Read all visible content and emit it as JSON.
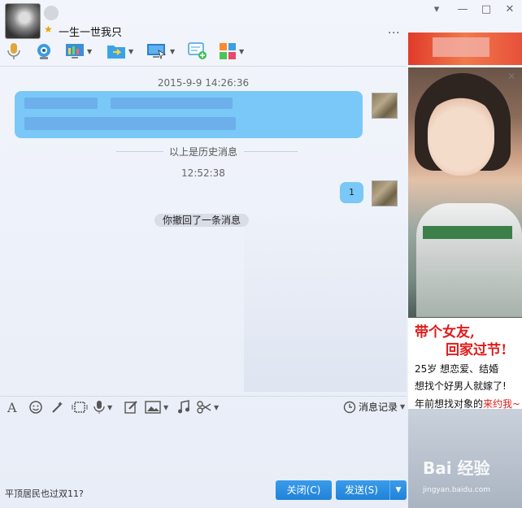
{
  "header": {
    "contact_name": "一生一世我只",
    "more_label": "···",
    "window_controls": [
      "▾",
      "—",
      "□",
      "✕"
    ]
  },
  "toolbar": {
    "icons": [
      "microphone-icon",
      "webcam-icon",
      "screen-share-icon",
      "file-transfer-icon",
      "remote-desktop-icon",
      "add-message-icon",
      "apps-icon"
    ]
  },
  "chat": {
    "timestamp_1": "2015-9-9 14:26:36",
    "history_divider": "以上是历史消息",
    "timestamp_2": "12:52:38",
    "my_message": "1",
    "recall_notice": "你撤回了一条消息"
  },
  "input_toolbar": {
    "history_label": "消息记录"
  },
  "footer": {
    "status_text": "平顶居民也过双11?",
    "close_label": "关闭(C)",
    "send_label": "发送(S)"
  },
  "ad": {
    "headline_1": "带个女友,",
    "headline_2": "回家过节!",
    "line_1": "25岁 想恋爱、结婚",
    "line_2": "想找个好男人就嫁了!",
    "line_3_prefix": "年前想找对象的",
    "line_3_highlight": "来约我~",
    "close_icon": "✕"
  },
  "watermark": {
    "brand": "Bai 经验",
    "url": "jingyan.baidu.com"
  }
}
